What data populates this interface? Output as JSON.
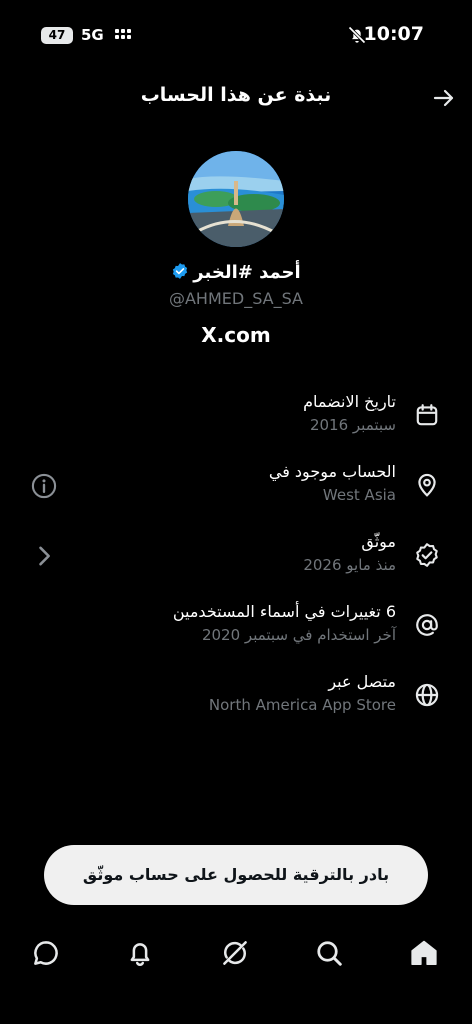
{
  "status": {
    "battery": "47",
    "network": "5G",
    "time": "10:07"
  },
  "header": {
    "title": "نبذة عن هذا الحساب",
    "back_icon": "arrow-right-icon"
  },
  "profile": {
    "name": "أحمد #الخبر",
    "handle": "@AHMED_SA_SA",
    "site": "X.com",
    "verified_color": "#1d9bf0"
  },
  "rows": [
    {
      "label": "تاريخ الانضمام",
      "sub": "سبتمبر 2016",
      "icon": "calendar-icon"
    },
    {
      "label": "الحساب موجود في",
      "sub": "West Asia",
      "icon": "location-pin-icon",
      "aux_icon": "info-icon"
    },
    {
      "label": "موثّق",
      "sub": "منذ مايو 2026",
      "icon": "verified-badge-icon",
      "aux_icon": "chevron-left-icon"
    },
    {
      "label": "6 تغييرات في أسماء المستخدمين",
      "sub": "آخر استخدام في سبتمبر 2020",
      "icon": "at-sign-icon"
    },
    {
      "label": "متصل عبر",
      "sub": "North America App Store",
      "icon": "globe-icon"
    }
  ],
  "upgrade": {
    "label": "بادر بالترقية للحصول على حساب موثّق"
  },
  "nav": [
    "home-icon",
    "search-icon",
    "grok-icon",
    "notifications-icon",
    "messages-icon"
  ]
}
